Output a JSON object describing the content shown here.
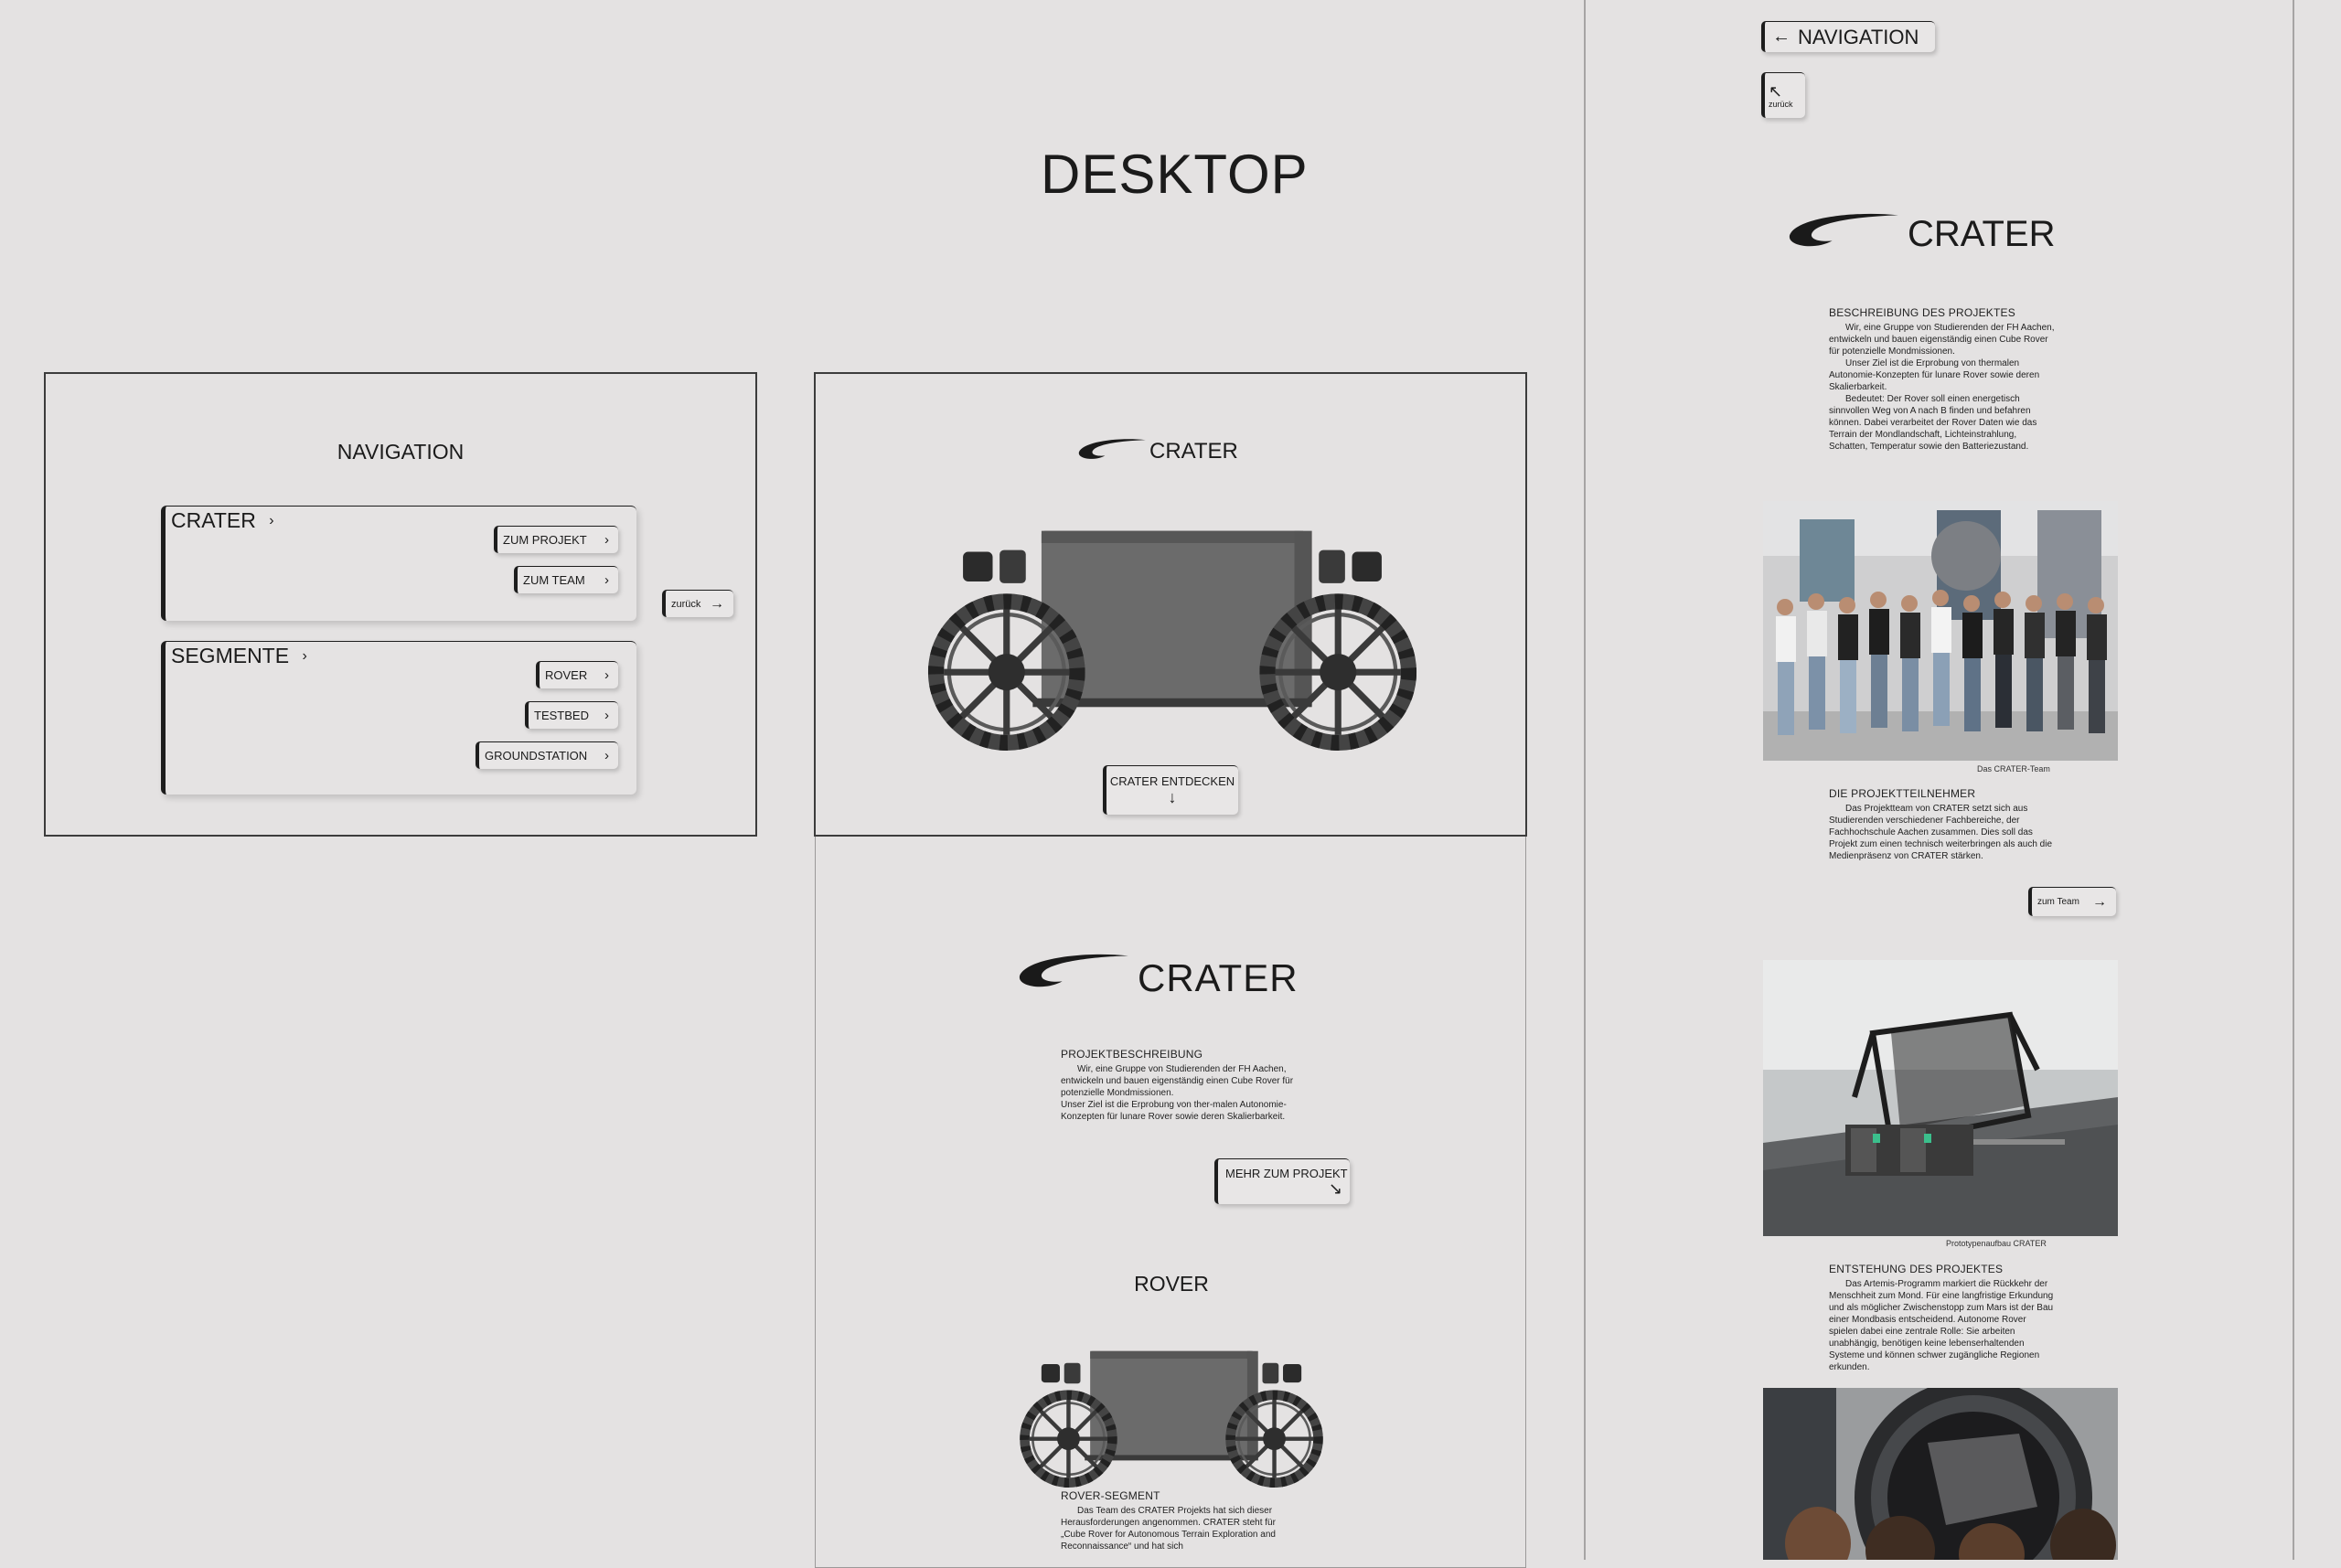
{
  "page_title": "DESKTOP",
  "nav_frame": {
    "title": "NAVIGATION",
    "group_crater": {
      "label": "CRATER",
      "chevron": "›",
      "items": [
        {
          "label": "ZUM PROJEKT"
        },
        {
          "label": "ZUM TEAM"
        }
      ]
    },
    "group_segmente": {
      "label": "SEGMENTE",
      "chevron": "›",
      "items": [
        {
          "label": "ROVER"
        },
        {
          "label": "TESTBED"
        },
        {
          "label": "GROUNDSTATION"
        }
      ]
    },
    "back_label": "zurück"
  },
  "hero_frame": {
    "brand": "CRATER",
    "cta_label": "CRATER ENTDECKEN",
    "cta_icon": "arrow-down-icon"
  },
  "scroll_frame": {
    "brand": "CRATER",
    "project_heading": "PROJEKTBESCHREIBUNG",
    "project_text": [
      "Wir, eine Gruppe von Studierenden der FH Aachen, entwickeln und bauen eigenständig einen Cube Rover für potenzielle Mondmissionen.",
      "Unser Ziel ist die Erprobung von ther-malen Autonomie-Konzepten für lunare Rover sowie deren Skalierbarkeit."
    ],
    "more_label": "MEHR ZUM PROJEKT",
    "rover_title": "ROVER",
    "rover_heading": "ROVER-SEGMENT",
    "rover_text": "Das Team des CRATER Projekts hat sich dieser Herausforderungen angenommen. CRATER steht für „Cube Rover for Autonomous Terrain Exploration and Reconnaissance“ und hat sich"
  },
  "detail_panel": {
    "nav_label": "NAVIGATION",
    "back_label": "zurück",
    "brand": "CRATER",
    "desc_heading": "BESCHREIBUNG DES PROJEKTES",
    "desc_text": [
      "Wir, eine Gruppe von Studierenden der FH Aachen, entwickeln und bauen eigenständig einen Cube Rover für potenzielle Mondmissionen.",
      "Unser Ziel ist die Erprobung von thermalen Autonomie-Konzepten für lunare Rover sowie deren Skalierbarkeit.",
      "Bedeutet: Der Rover soll einen energetisch sinnvollen Weg von A nach B finden und befahren können. Dabei verarbeitet der Rover Daten wie das Terrain der Mondlandschaft, Lichteinstrahlung, Schatten, Temperatur sowie den Batteriezustand."
    ],
    "team_caption": "Das CRATER-Team",
    "participants_heading": "DIE PROJEKTTEILNEHMER",
    "participants_text": "Das Projektteam von CRATER setzt sich aus Studierenden verschiedener Fachbereiche, der Fachhochschule Aachen zusammen. Dies soll das Projekt zum einen technisch weiterbringen als auch die Medienpräsenz von CRATER stärken.",
    "team_button": "zum Team",
    "prototype_caption": "Prototypenaufbau CRATER",
    "origin_heading": "ENTSTEHUNG DES PROJEKTES",
    "origin_text": "Das Artemis-Programm markiert die Rückkehr der Menschheit zum Mond. Für eine langfristige Erkundung und als möglicher Zwischenstopp zum Mars ist der Bau einer Mondbasis entscheidend. Autonome Rover spielen dabei eine zentrale Rolle: Sie arbeiten unabhängig, benötigen keine lebenserhaltenden Systeme und können schwer zugängliche Regionen erkunden."
  },
  "colors": {
    "background": "#e4e2e2",
    "ink": "#1b1b1b",
    "frame": "#3c3c3c"
  }
}
